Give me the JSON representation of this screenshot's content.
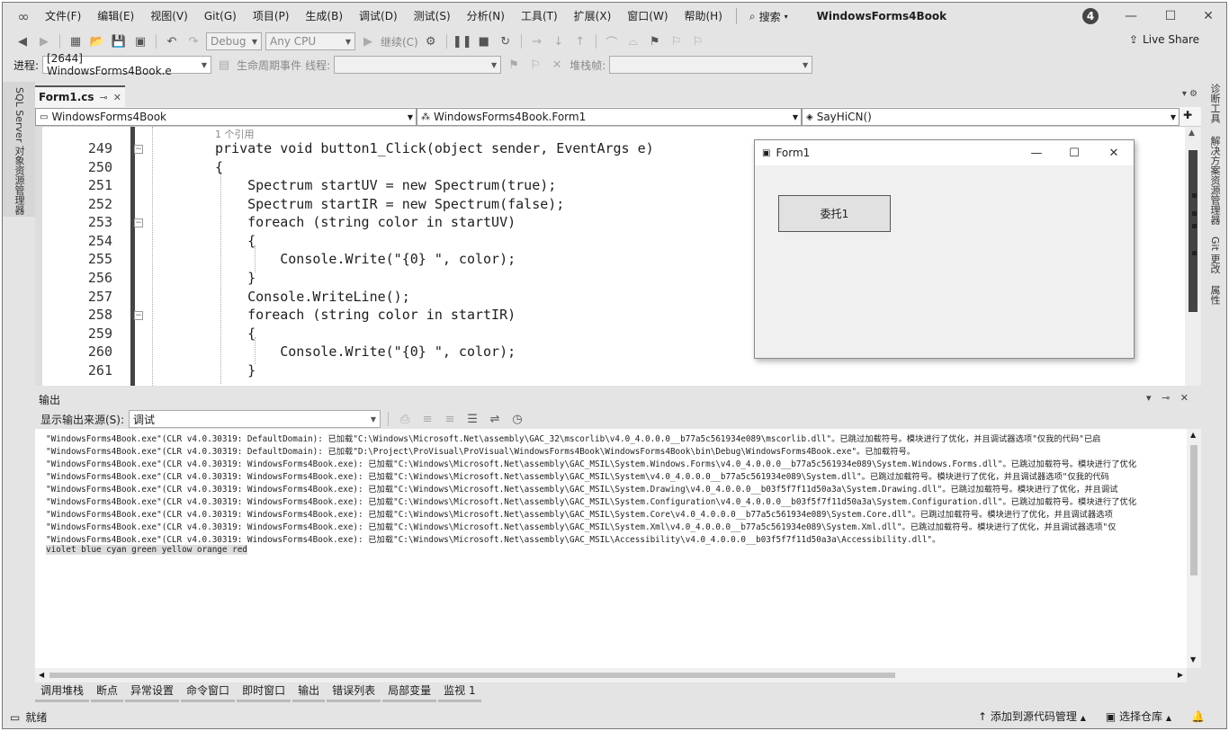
{
  "menubar": {
    "items": [
      "文件(F)",
      "编辑(E)",
      "视图(V)",
      "Git(G)",
      "项目(P)",
      "生成(B)",
      "调试(D)",
      "测试(S)",
      "分析(N)",
      "工具(T)",
      "扩展(X)",
      "窗口(W)",
      "帮助(H)"
    ],
    "search_label": "搜索",
    "app_title": "WindowsForms4Book",
    "notification_count": "4"
  },
  "toolbar1": {
    "config": "Debug",
    "platform": "Any CPU",
    "continue_label": "继续(C)",
    "live_share": "Live Share"
  },
  "toolbar2": {
    "process_label": "进程:",
    "process_value": "[2644] WindowsForms4Book.e",
    "lifecycle_label": "生命周期事件",
    "thread_label": "线程:",
    "stack_label": "堆栈帧:"
  },
  "left_strip": {
    "label": "SQL Server 对象资源管理器"
  },
  "right_strip": {
    "labels": [
      "诊断工具",
      "解决方案资源管理器",
      "Git 更改",
      "属性"
    ]
  },
  "editor": {
    "tab_title": "Form1.cs",
    "nav": {
      "project": "WindowsForms4Book",
      "class": "WindowsForms4Book.Form1",
      "member": "SayHiCN()"
    },
    "codelens": "1 个引用",
    "line_numbers": [
      "249",
      "250",
      "251",
      "252",
      "253",
      "254",
      "255",
      "256",
      "257",
      "258",
      "259",
      "260",
      "261"
    ],
    "lines": [
      "private void button1_Click(object sender, EventArgs e)",
      "{",
      "    Spectrum startUV = new Spectrum(true);",
      "    Spectrum startIR = new Spectrum(false);",
      "    foreach (string color in startUV)",
      "    {",
      "        Console.Write(\"{0} \", color);",
      "    }",
      "    Console.WriteLine();",
      "    foreach (string color in startIR)",
      "    {",
      "        Console.Write(\"{0} \", color);",
      "    }"
    ]
  },
  "form1": {
    "title": "Form1",
    "button_label": "委托1"
  },
  "output": {
    "title": "输出",
    "source_label": "显示输出来源(S):",
    "source_value": "调试",
    "lines": [
      "\"WindowsForms4Book.exe\"(CLR v4.0.30319: DefaultDomain): 已加载\"C:\\Windows\\Microsoft.Net\\assembly\\GAC_32\\mscorlib\\v4.0_4.0.0.0__b77a5c561934e089\\mscorlib.dll\"。已跳过加载符号。模块进行了优化，并且调试器选项\"仅我的代码\"已启",
      "\"WindowsForms4Book.exe\"(CLR v4.0.30319: DefaultDomain): 已加载\"D:\\Project\\ProVisual\\ProVisual\\WindowsForms4Book\\WindowsForms4Book\\bin\\Debug\\WindowsForms4Book.exe\"。已加载符号。",
      "\"WindowsForms4Book.exe\"(CLR v4.0.30319: WindowsForms4Book.exe): 已加载\"C:\\Windows\\Microsoft.Net\\assembly\\GAC_MSIL\\System.Windows.Forms\\v4.0_4.0.0.0__b77a5c561934e089\\System.Windows.Forms.dll\"。已跳过加载符号。模块进行了优化",
      "\"WindowsForms4Book.exe\"(CLR v4.0.30319: WindowsForms4Book.exe): 已加载\"C:\\Windows\\Microsoft.Net\\assembly\\GAC_MSIL\\System\\v4.0_4.0.0.0__b77a5c561934e089\\System.dll\"。已跳过加载符号。模块进行了优化，并且调试器选项\"仅我的代码",
      "\"WindowsForms4Book.exe\"(CLR v4.0.30319: WindowsForms4Book.exe): 已加载\"C:\\Windows\\Microsoft.Net\\assembly\\GAC_MSIL\\System.Drawing\\v4.0_4.0.0.0__b03f5f7f11d50a3a\\System.Drawing.dll\"。已跳过加载符号。模块进行了优化，并且调试",
      "\"WindowsForms4Book.exe\"(CLR v4.0.30319: WindowsForms4Book.exe): 已加载\"C:\\Windows\\Microsoft.Net\\assembly\\GAC_MSIL\\System.Configuration\\v4.0_4.0.0.0__b03f5f7f11d50a3a\\System.Configuration.dll\"。已跳过加载符号。模块进行了优化",
      "\"WindowsForms4Book.exe\"(CLR v4.0.30319: WindowsForms4Book.exe): 已加载\"C:\\Windows\\Microsoft.Net\\assembly\\GAC_MSIL\\System.Core\\v4.0_4.0.0.0__b77a5c561934e089\\System.Core.dll\"。已跳过加载符号。模块进行了优化，并且调试器选项",
      "\"WindowsForms4Book.exe\"(CLR v4.0.30319: WindowsForms4Book.exe): 已加载\"C:\\Windows\\Microsoft.Net\\assembly\\GAC_MSIL\\System.Xml\\v4.0_4.0.0.0__b77a5c561934e089\\System.Xml.dll\"。已跳过加载符号。模块进行了优化，并且调试器选项\"仅",
      "\"WindowsForms4Book.exe\"(CLR v4.0.30319: WindowsForms4Book.exe): 已加载\"C:\\Windows\\Microsoft.Net\\assembly\\GAC_MSIL\\Accessibility\\v4.0_4.0.0.0__b03f5f7f11d50a3a\\Accessibility.dll\"。",
      "violet blue cyan green yellow orange red"
    ]
  },
  "bottom_tabs": [
    "调用堆栈",
    "断点",
    "异常设置",
    "命令窗口",
    "即时窗口",
    "输出",
    "错误列表",
    "局部变量",
    "监视 1"
  ],
  "status": {
    "ready": "就绪",
    "add_source": "添加到源代码管理",
    "select_repo": "选择仓库"
  }
}
